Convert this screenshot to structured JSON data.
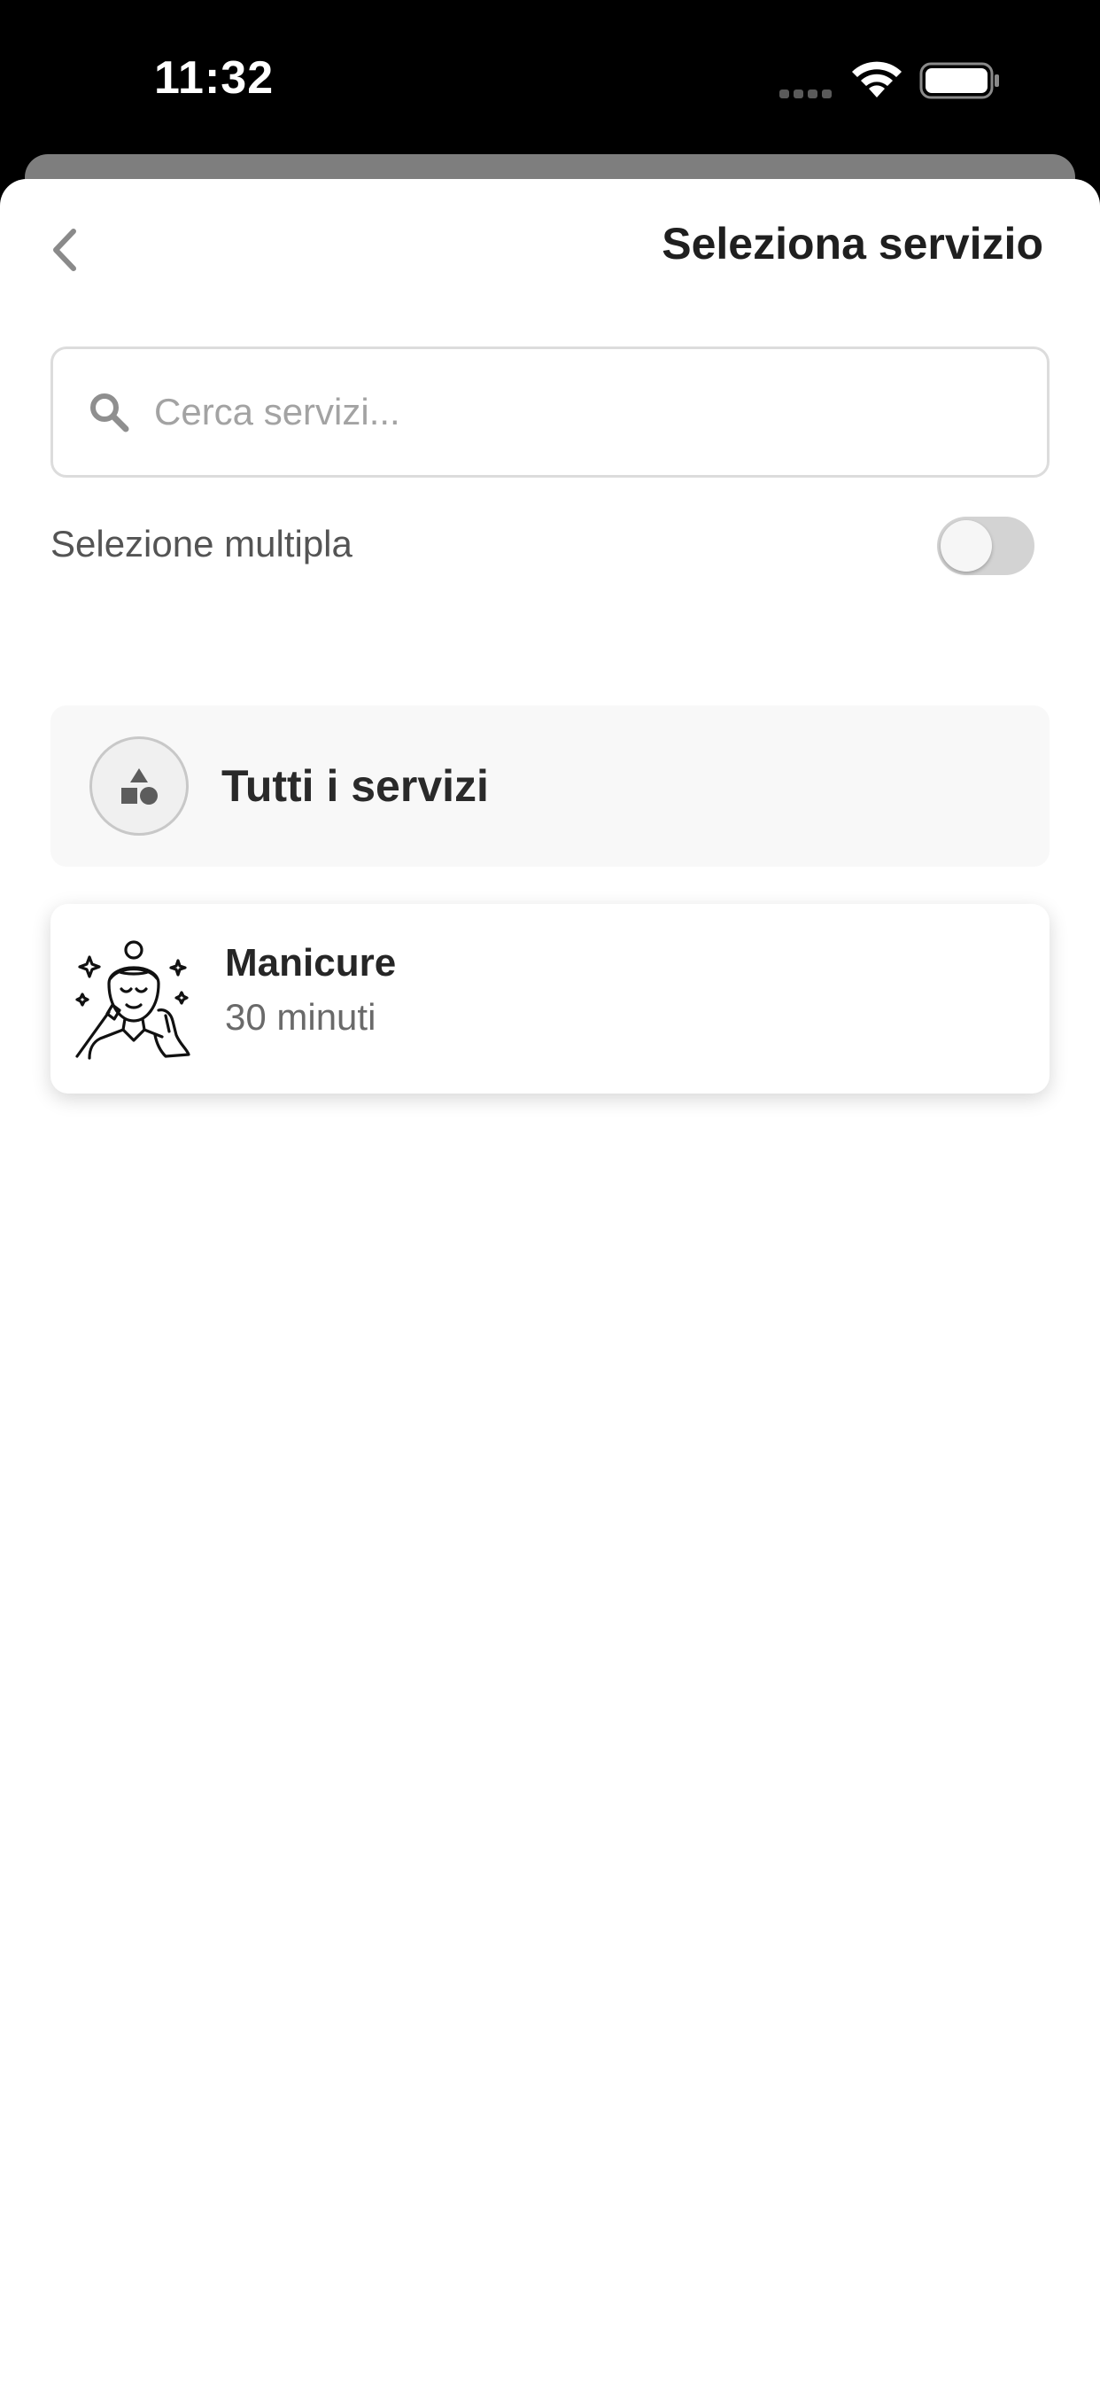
{
  "status_bar": {
    "time": "11:32"
  },
  "header": {
    "title": "Seleziona servizio",
    "back_icon": "chevron-left-icon"
  },
  "search": {
    "placeholder": "Cerca servizi...",
    "value": "",
    "icon": "search-icon"
  },
  "multi_select": {
    "label": "Selezione multipla",
    "enabled": false
  },
  "all_services": {
    "label": "Tutti i servizi",
    "icon": "shapes-icon"
  },
  "services": [
    {
      "name": "Manicure",
      "duration": "30 minuti",
      "icon": "woman-beauty-illustration"
    }
  ],
  "colors": {
    "text_primary": "#1f1f1f",
    "text_secondary": "#6a6a6a",
    "toggle_off": "#d3d3d3",
    "card_background": "#f8f8f8"
  }
}
